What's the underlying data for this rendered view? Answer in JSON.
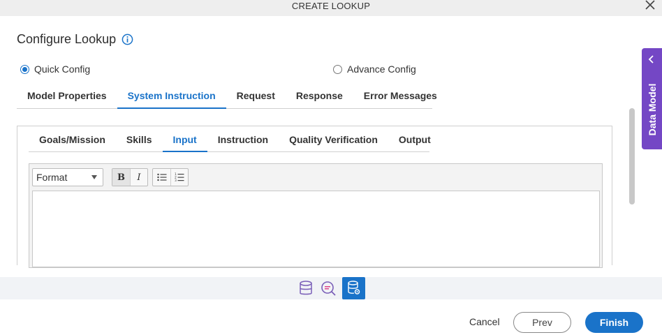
{
  "dialog": {
    "title": "CREATE LOOKUP"
  },
  "page": {
    "heading": "Configure Lookup"
  },
  "config_modes": [
    {
      "label": "Quick Config",
      "selected": true
    },
    {
      "label": "Advance Config",
      "selected": false
    }
  ],
  "main_tabs": [
    {
      "label": "Model Properties"
    },
    {
      "label": "System Instruction"
    },
    {
      "label": "Request"
    },
    {
      "label": "Response"
    },
    {
      "label": "Error Messages"
    }
  ],
  "main_tabs_active": "System Instruction",
  "instruction_tabs": [
    {
      "label": "Goals/Mission"
    },
    {
      "label": "Skills"
    },
    {
      "label": "Input"
    },
    {
      "label": "Instruction"
    },
    {
      "label": "Quality Verification"
    },
    {
      "label": "Output"
    }
  ],
  "instruction_tabs_active": "Input",
  "editor": {
    "format_select": "Format",
    "bold_label": "B",
    "italic_label": "I",
    "content": ""
  },
  "bottom_icons": [
    "database-icon",
    "chat-search-icon",
    "database-settings-icon"
  ],
  "footer": {
    "cancel": "Cancel",
    "prev": "Prev",
    "finish": "Finish"
  },
  "side_panel": {
    "label": "Data Model"
  },
  "colors": {
    "accent": "#1a73c9",
    "side_panel": "#7447c5",
    "title_bar": "#eeeeee"
  }
}
